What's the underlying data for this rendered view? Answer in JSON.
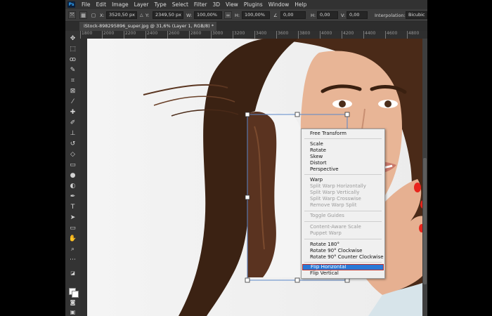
{
  "menu": {
    "logo": "Ps",
    "items": [
      "File",
      "Edit",
      "Image",
      "Layer",
      "Type",
      "Select",
      "Filter",
      "3D",
      "View",
      "Plugins",
      "Window",
      "Help"
    ]
  },
  "options": {
    "x_label": "X:",
    "x_value": "3520,50 px",
    "y_label": "Y:",
    "y_value": "2349,50 px",
    "w_label": "W:",
    "w_value": "100,00%",
    "h_label": "H:",
    "h_value": "100,00%",
    "angle_value": "0,00",
    "hskew_label": "H:",
    "hskew_value": "0,00",
    "vskew_label": "V:",
    "vskew_value": "0,00",
    "interp_label": "Interpolation:",
    "interp_value": "Bicubic"
  },
  "document": {
    "tab_title": "iStock-898295896_super.jpg @ 31,6% (Layer 1, RGB/8) *"
  },
  "ruler": {
    "ticks": [
      "1800",
      "2000",
      "2200",
      "2400",
      "2600",
      "2800",
      "3000",
      "3200",
      "3400",
      "3600",
      "3800",
      "4000",
      "4200",
      "4400",
      "4600",
      "4800"
    ]
  },
  "context_menu": {
    "items": [
      {
        "label": "Free Transform",
        "enabled": true
      },
      {
        "sep": true
      },
      {
        "label": "Scale",
        "enabled": true
      },
      {
        "label": "Rotate",
        "enabled": true
      },
      {
        "label": "Skew",
        "enabled": true
      },
      {
        "label": "Distort",
        "enabled": true
      },
      {
        "label": "Perspective",
        "enabled": true
      },
      {
        "sep": true
      },
      {
        "label": "Warp",
        "enabled": true
      },
      {
        "label": "Split Warp Horizontally",
        "enabled": false
      },
      {
        "label": "Split Warp Vertically",
        "enabled": false
      },
      {
        "label": "Split Warp Crosswise",
        "enabled": false
      },
      {
        "label": "Remove Warp Split",
        "enabled": false
      },
      {
        "sep": true
      },
      {
        "label": "Toggle Guides",
        "enabled": false
      },
      {
        "sep": true
      },
      {
        "label": "Content-Aware Scale",
        "enabled": false
      },
      {
        "label": "Puppet Warp",
        "enabled": false
      },
      {
        "sep": true
      },
      {
        "label": "Rotate 180°",
        "enabled": true
      },
      {
        "label": "Rotate 90° Clockwise",
        "enabled": true
      },
      {
        "label": "Rotate 90° Counter Clockwise",
        "enabled": true
      },
      {
        "sep": true
      },
      {
        "label": "Flip Horizontal",
        "enabled": true,
        "selected": true
      },
      {
        "label": "Flip Vertical",
        "enabled": true
      }
    ]
  },
  "tools": [
    "move-icon",
    "marquee-icon",
    "lasso-icon",
    "quick-select-icon",
    "crop-icon",
    "frame-icon",
    "eyedropper-icon",
    "healing-icon",
    "brush-icon",
    "stamp-icon",
    "history-brush-icon",
    "eraser-icon",
    "gradient-icon",
    "blur-icon",
    "dodge-icon",
    "pen-icon",
    "type-icon",
    "path-select-icon",
    "rectangle-icon",
    "hand-icon",
    "zoom-icon",
    "more-icon"
  ],
  "colors": {
    "selection": "#2a78d6",
    "selection_outline": "#c0302b"
  }
}
